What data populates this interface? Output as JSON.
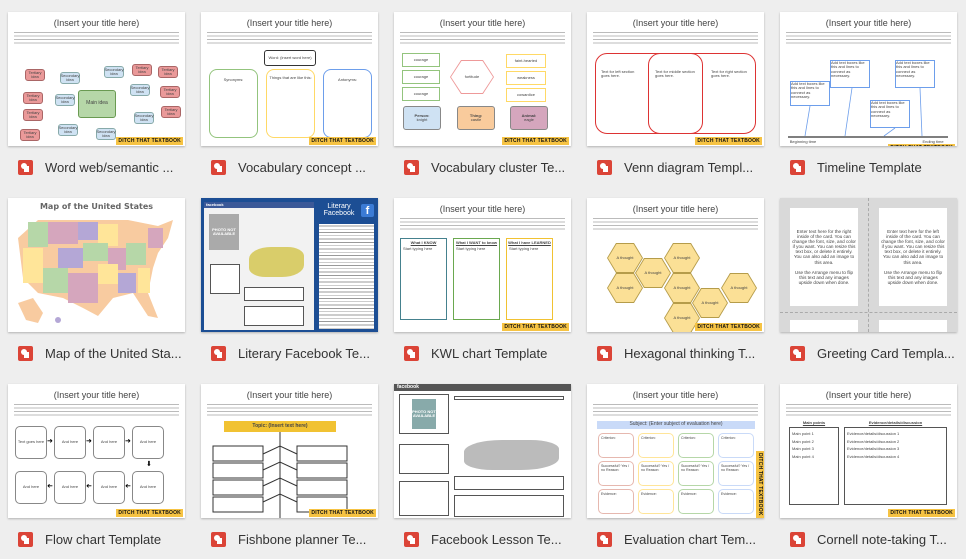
{
  "colors": {
    "file_icon": "#db4437",
    "badge": "#f6c343"
  },
  "common": {
    "title": "(Insert your title here)",
    "badge": "DITCH THAT TEXTBOOK"
  },
  "files": [
    {
      "name": "Word web/semantic ...",
      "icon": "slides-icon"
    },
    {
      "name": "Vocabulary concept ...",
      "icon": "slides-icon"
    },
    {
      "name": "Vocabulary cluster Te...",
      "icon": "slides-icon"
    },
    {
      "name": "Venn diagram Templ...",
      "icon": "slides-icon"
    },
    {
      "name": "Timeline Template",
      "icon": "slides-icon"
    },
    {
      "name": "Map of the United Sta...",
      "icon": "slides-icon"
    },
    {
      "name": "Literary Facebook Te...",
      "icon": "slides-icon"
    },
    {
      "name": "KWL chart Template",
      "icon": "slides-icon"
    },
    {
      "name": "Hexagonal thinking T...",
      "icon": "slides-icon"
    },
    {
      "name": "Greeting Card Templa...",
      "icon": "slides-icon"
    },
    {
      "name": "Flow chart Template",
      "icon": "slides-icon"
    },
    {
      "name": "Fishbone planner Te...",
      "icon": "slides-icon"
    },
    {
      "name": "Facebook Lesson Te...",
      "icon": "slides-icon"
    },
    {
      "name": "Evaluation chart Tem...",
      "icon": "slides-icon"
    },
    {
      "name": "Cornell note-taking T...",
      "icon": "slides-icon"
    }
  ],
  "thumbs": {
    "wordweb": {
      "main": "Main idea",
      "secondary": "Secondary idea",
      "tertiary": "Tertiary idea"
    },
    "vocab": {
      "word": "Word: (insert word here)",
      "cols": [
        "Synonyms:",
        "Things that are like this:",
        "Antonyms:"
      ],
      "placeholder": "(Insert text here)"
    },
    "cluster": {
      "left": "courage",
      "hex": "fortitude",
      "right": [
        "faint-hearted",
        "weakness",
        "cowardice"
      ],
      "bottom": [
        {
          "h": "Person:",
          "v": "knight"
        },
        {
          "h": "Thing:",
          "v": "castle"
        },
        {
          "h": "Animal:",
          "v": "eagle"
        }
      ]
    },
    "venn": {
      "left": "Text for left section goes here.",
      "mid": "Text for middle section goes here.",
      "right": "Text for right section goes here."
    },
    "timeline": {
      "box": "Add text boxes like this and lines to connect as necessary.",
      "begin": "Beginning time",
      "end": "Ending time"
    },
    "map": {
      "title": "Map of the United States"
    },
    "litfb": {
      "title": "Literary Facebook",
      "brand": "facebook",
      "photo": "PHOTO NOT AVAILABLE"
    },
    "kwl": {
      "cols": [
        "What I KNOW",
        "What I WANT to know",
        "What I have LEARNED"
      ],
      "placeholder": "Start typing here"
    },
    "hexag": {
      "cell": "A thought"
    },
    "greeting": {
      "right": "Enter text here for the right inside of the card. You can change the font, size, and color if you want. You can resize this text box, or delete it entirely. You can also add an image to this area.",
      "left": "Enter text here for the left inside of the card. You can change the font, size, and color if you want. You can resize this text box, or delete it entirely. You can also add an image to this area.",
      "arrange": "Use the Arrange menu to flip this text and any images upside down when done."
    },
    "flow": {
      "first": "Text goes here",
      "next": "And here"
    },
    "fishbone": {
      "topic": "Topic: (Insert text here)"
    },
    "fblesson": {
      "brand": "facebook",
      "photo": "PHOTO NOT AVAILABLE"
    },
    "eval": {
      "subject": "Subject: (Enter subject of evaluation here)",
      "row1": "Criterion:",
      "row2": "Successful? Yes / no Reason:",
      "row3": "Evidence:"
    },
    "cornell": {
      "left_head": "Main points",
      "right_head": "Evidence/details/discussion",
      "points": [
        "Main point 1",
        "Main point 2",
        "Main point 3",
        "Main point 4"
      ],
      "evidence": [
        "Evidence/details/discussion 1",
        "Evidence/details/discussion 2",
        "Evidence/details/discussion 3",
        "Evidence/details/discussion 4"
      ]
    }
  }
}
